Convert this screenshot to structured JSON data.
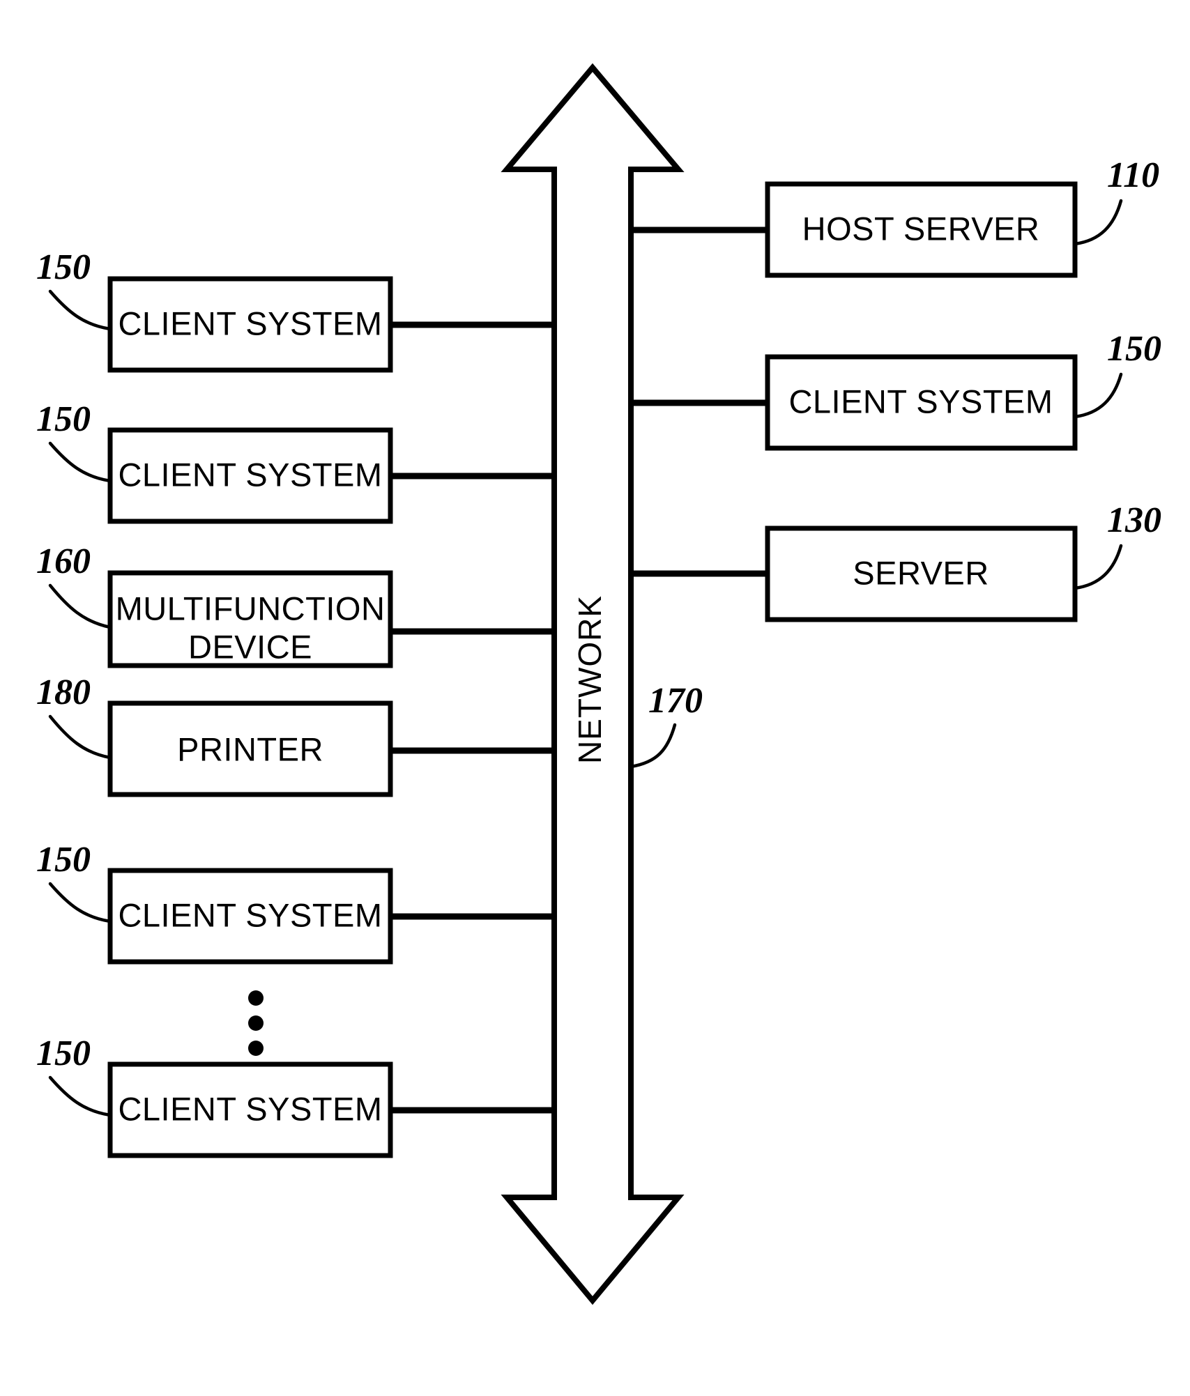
{
  "figure": {
    "title": "Network system block diagram",
    "background_color": "#ffffff",
    "line_color": "#000000"
  },
  "network": {
    "label": "NETWORK",
    "ref": "170",
    "orientation": "vertical-double-arrow"
  },
  "ellipsis": {
    "symbol": "vertical-ellipsis",
    "dot_count": 3
  },
  "left_nodes": [
    {
      "label": "CLIENT SYSTEM",
      "ref": "150",
      "lines": [
        "CLIENT SYSTEM"
      ]
    },
    {
      "label": "CLIENT SYSTEM",
      "ref": "150",
      "lines": [
        "CLIENT SYSTEM"
      ]
    },
    {
      "label": "MULTIFUNCTION DEVICE",
      "ref": "160",
      "lines": [
        "MULTIFUNCTION",
        "DEVICE"
      ]
    },
    {
      "label": "PRINTER",
      "ref": "180",
      "lines": [
        "PRINTER"
      ]
    },
    {
      "label": "CLIENT SYSTEM",
      "ref": "150",
      "lines": [
        "CLIENT SYSTEM"
      ]
    },
    {
      "label": "CLIENT SYSTEM",
      "ref": "150",
      "lines": [
        "CLIENT SYSTEM"
      ]
    }
  ],
  "right_nodes": [
    {
      "label": "HOST SERVER",
      "ref": "110",
      "lines": [
        "HOST SERVER"
      ]
    },
    {
      "label": "CLIENT SYSTEM",
      "ref": "150",
      "lines": [
        "CLIENT SYSTEM"
      ]
    },
    {
      "label": "SERVER",
      "ref": "130",
      "lines": [
        "SERVER"
      ]
    }
  ],
  "text": {
    "l0_label": "CLIENT SYSTEM",
    "l0_ref": "150",
    "l1_label": "CLIENT SYSTEM",
    "l1_ref": "150",
    "l2_label_a": "MULTIFUNCTION",
    "l2_label_b": "DEVICE",
    "l2_ref": "160",
    "l3_label": "PRINTER",
    "l3_ref": "180",
    "l4_label": "CLIENT SYSTEM",
    "l4_ref": "150",
    "l5_label": "CLIENT SYSTEM",
    "l5_ref": "150",
    "r0_label": "HOST SERVER",
    "r0_ref": "110",
    "r1_label": "CLIENT SYSTEM",
    "r1_ref": "150",
    "r2_label": "SERVER",
    "r2_ref": "130",
    "network_label": "NETWORK",
    "network_ref": "170"
  }
}
